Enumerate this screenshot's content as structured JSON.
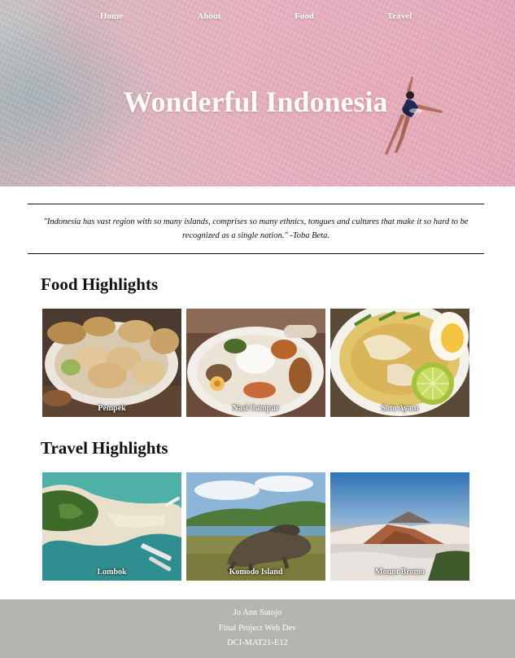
{
  "nav": {
    "items": [
      {
        "label": "Home"
      },
      {
        "label": "About"
      },
      {
        "label": "Food"
      },
      {
        "label": "Travel"
      }
    ]
  },
  "hero": {
    "title": "Wonderful Indonesia",
    "image": "pink-beach-swimmer"
  },
  "quote": {
    "text": "\"Indonesia has vast region with so many islands, comprises so many ethnics, tongues and cultures that make it so hard to be recognized as a single nation.\" -Toba Beta."
  },
  "food": {
    "title": "Food Highlights",
    "items": [
      {
        "caption": "Pempek"
      },
      {
        "caption": "Nasi Campur"
      },
      {
        "caption": "Soto Ayam"
      }
    ]
  },
  "travel": {
    "title": "Travel Highlights",
    "items": [
      {
        "caption": "Lombok"
      },
      {
        "caption": "Komodo Island"
      },
      {
        "caption": "Mount Bromo"
      }
    ]
  },
  "footer": {
    "line1": "Jo Ann Sutojo",
    "line2": "Final Project Web Dev",
    "line3": "DCI-MAT21-E12"
  },
  "colors": {
    "footer_bg": "#b6b4b1",
    "hero_pink": "#e7b2c1",
    "text": "#111111"
  }
}
